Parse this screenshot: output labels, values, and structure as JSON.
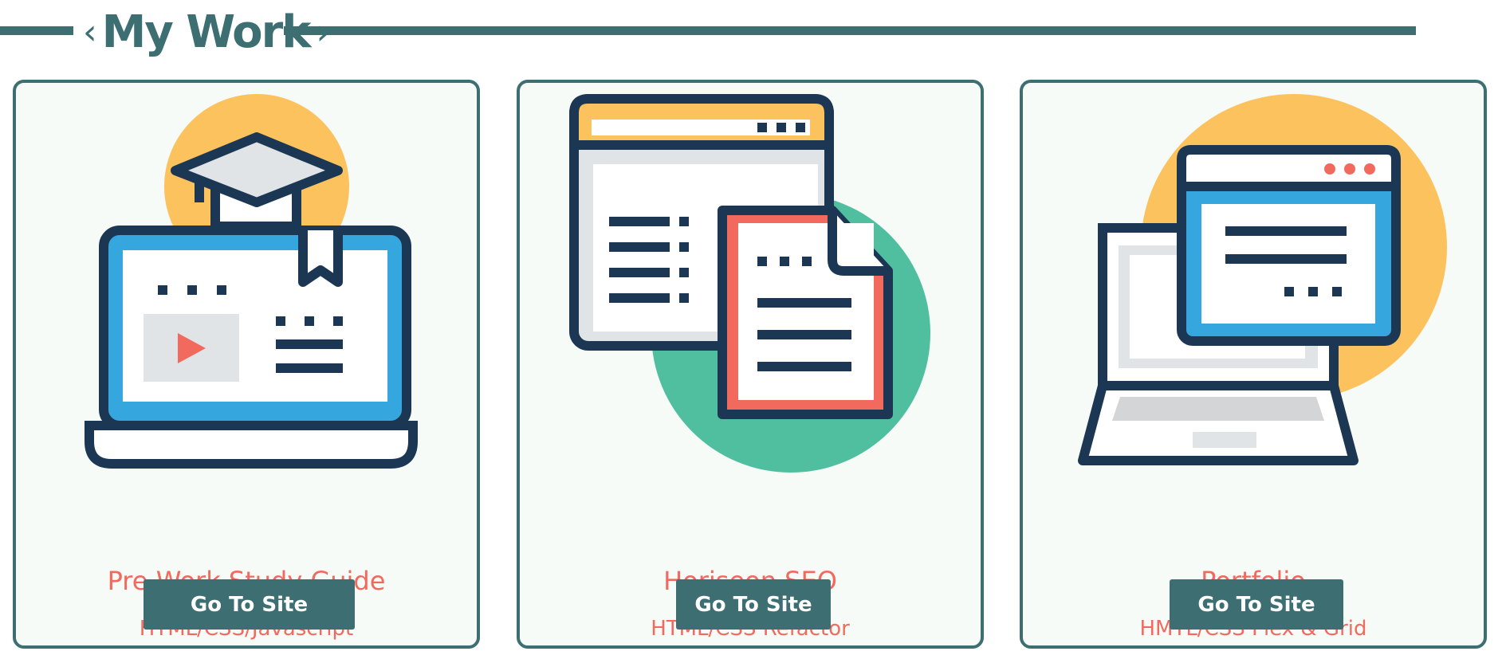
{
  "section": {
    "title": "My Work",
    "chevron_left": "‹",
    "chevron_right": "›"
  },
  "colors": {
    "teal": "#3c6e72",
    "coral": "#f26a5e",
    "yellow": "#fbc25e",
    "green": "#4fbf9f",
    "blue": "#36a6df",
    "navy": "#1c3754",
    "card_bg": "#f6fbf7"
  },
  "projects": [
    {
      "title": "Pre-Work Study Guide",
      "subtitle": "HTML/CSS/Javascript",
      "button": "Go To Site",
      "icon": "laptop-graduation-cap-icon"
    },
    {
      "title": "Horiseon SEO",
      "subtitle": "HTML/CSS Refactor",
      "button": "Go To Site",
      "icon": "browser-document-icon"
    },
    {
      "title": "Portfolio",
      "subtitle": "HMTL/CSS Flex & Grid",
      "button": "Go To Site",
      "icon": "laptop-browser-window-icon"
    }
  ]
}
